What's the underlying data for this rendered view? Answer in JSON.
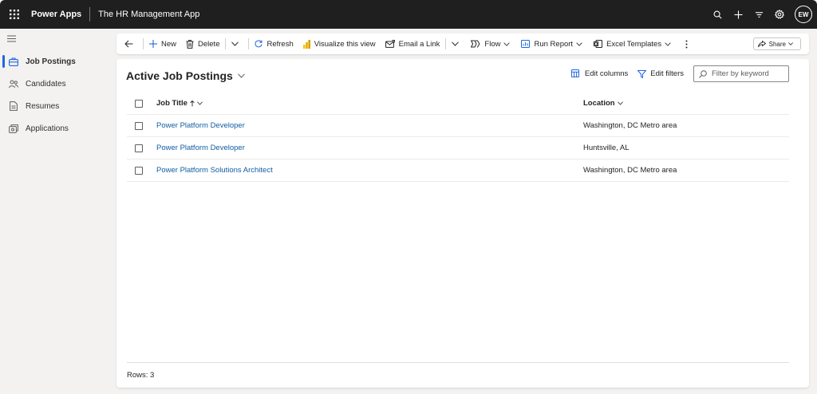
{
  "topbar": {
    "brand": "Power Apps",
    "app_title": "The HR Management App",
    "avatar_initials": "EW",
    "icons": [
      "waffle-icon",
      "search-icon",
      "plus-icon",
      "filter-icon",
      "gear-icon"
    ]
  },
  "sidebar": {
    "items": [
      {
        "label": "Job Postings",
        "icon": "briefcase-icon",
        "active": true
      },
      {
        "label": "Candidates",
        "icon": "people-icon",
        "active": false
      },
      {
        "label": "Resumes",
        "icon": "document-icon",
        "active": false
      },
      {
        "label": "Applications",
        "icon": "applications-icon",
        "active": false
      }
    ]
  },
  "commandbar": {
    "new": "New",
    "delete": "Delete",
    "refresh": "Refresh",
    "visualize": "Visualize this view",
    "email": "Email a Link",
    "flow": "Flow",
    "run_report": "Run Report",
    "excel_templates": "Excel Templates",
    "share": "Share"
  },
  "view": {
    "title": "Active Job Postings",
    "edit_columns": "Edit columns",
    "edit_filters": "Edit filters",
    "filter_placeholder": "Filter by keyword"
  },
  "grid": {
    "columns": [
      "Job Title",
      "Location"
    ],
    "rows": [
      {
        "title": "Power Platform Developer",
        "location": "Washington, DC Metro area"
      },
      {
        "title": "Power Platform Developer",
        "location": "Huntsville, AL"
      },
      {
        "title": "Power Platform Solutions Architect",
        "location": "Washington, DC Metro area"
      }
    ],
    "row_count": "Rows: 3"
  },
  "colors": {
    "topbar_bg": "#1f1f1f",
    "accent": "#2266e3",
    "link": "#115ea3",
    "background": "#f3f2f1"
  }
}
